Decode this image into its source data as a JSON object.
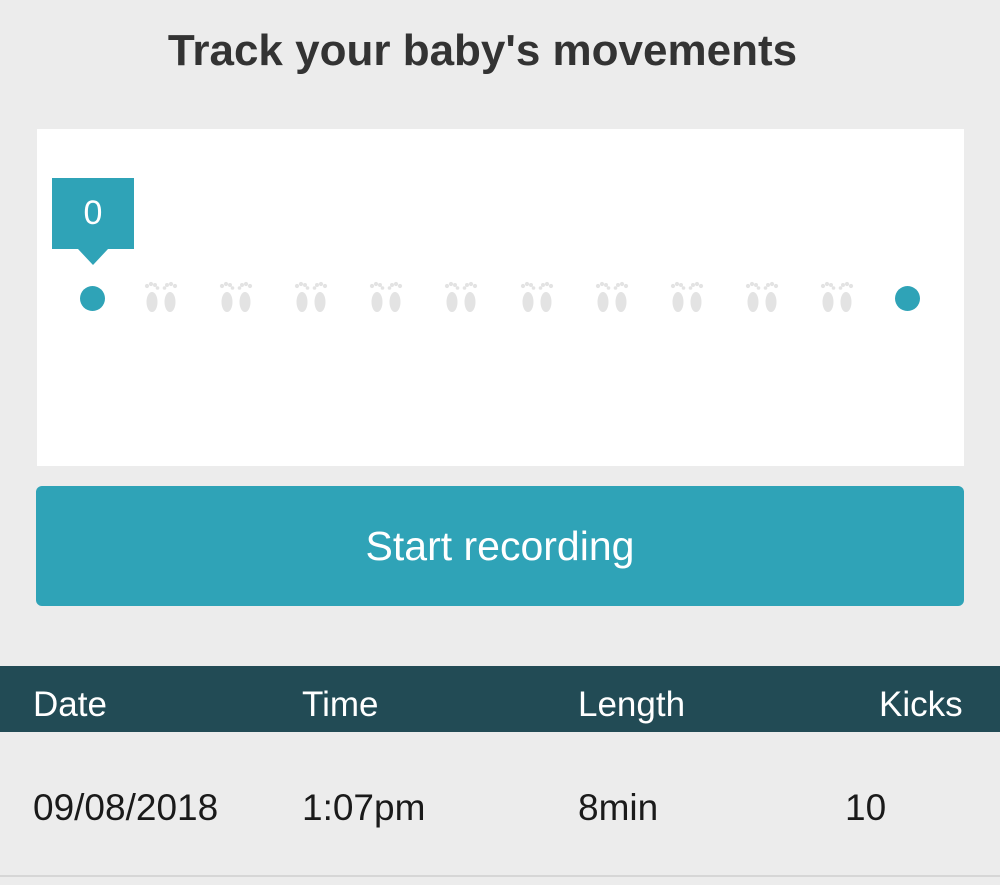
{
  "title": "Track your baby's movements",
  "tracker": {
    "kick_count": "0",
    "footprint_icon": "baby-feet-icon",
    "footprint_slots": 10
  },
  "actions": {
    "start_label": "Start recording"
  },
  "table": {
    "headers": [
      "Date",
      "Time",
      "Length",
      "Kicks"
    ],
    "rows": [
      [
        "09/08/2018",
        "1:07pm",
        "8min",
        "10"
      ]
    ]
  },
  "colors": {
    "accent": "#2fa3b7",
    "header_bg": "#224b55",
    "background": "#ececec",
    "card": "#ffffff",
    "footprint": "#e3e3e3"
  }
}
